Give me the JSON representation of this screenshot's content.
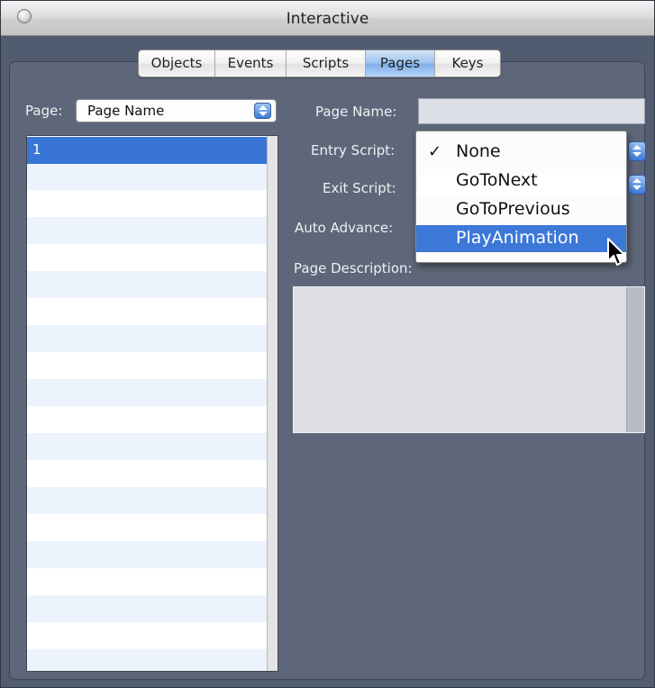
{
  "window": {
    "title": "Interactive"
  },
  "tabs": [
    {
      "label": "Objects"
    },
    {
      "label": "Events"
    },
    {
      "label": "Scripts"
    },
    {
      "label": "Pages"
    },
    {
      "label": "Keys"
    }
  ],
  "active_tab": "Pages",
  "page_selector": {
    "label": "Page:",
    "value": "Page Name"
  },
  "page_list": {
    "items": [
      "1"
    ],
    "selected_index": 0
  },
  "form": {
    "page_name_label": "Page Name:",
    "page_name_value": "",
    "entry_script_label": "Entry Script:",
    "exit_script_label": "Exit Script:",
    "auto_advance_label": "Auto Advance:",
    "page_description_label": "Page Description:",
    "page_description_value": ""
  },
  "entry_script_menu": {
    "items": [
      {
        "label": "None",
        "checked": true
      },
      {
        "label": "GoToNext",
        "checked": false
      },
      {
        "label": "GoToPrevious",
        "checked": false
      },
      {
        "label": "PlayAnimation",
        "checked": false,
        "highlighted": true
      }
    ],
    "check_glyph": "✓"
  },
  "colors": {
    "accent": "#3875d7",
    "panel": "#5e6779",
    "selection": "#3c78d8"
  }
}
